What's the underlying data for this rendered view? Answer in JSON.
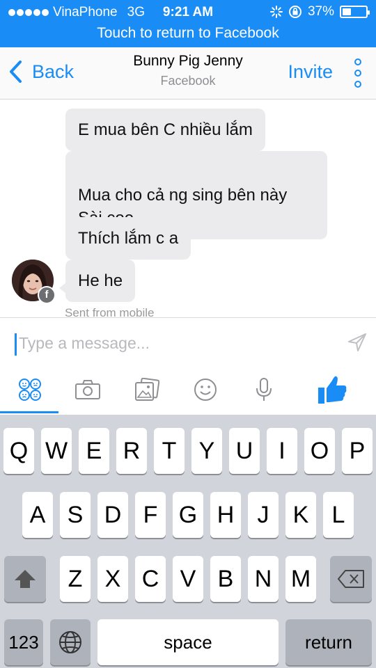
{
  "status_bar": {
    "carrier": "VinaPhone",
    "network": "3G",
    "time": "9:21 AM",
    "battery_percent": "37%",
    "battery_level": 0.37,
    "icons": [
      "signal-dots-icon",
      "activity-spinner-icon",
      "rotation-lock-icon",
      "battery-icon"
    ]
  },
  "return_bar": {
    "label": "Touch to return to Facebook"
  },
  "nav": {
    "back_label": "Back",
    "title": "Bunny Pig Jenny",
    "subtitle": "Facebook",
    "invite_label": "Invite",
    "more_icon": "vertical-dots-icon"
  },
  "messages": [
    {
      "text": "E mua bên C nhiều lắm"
    },
    {
      "text": "Mua cho cả ng sing bên này\nSài coe"
    },
    {
      "text": "Thích lắm c a"
    },
    {
      "text": "He he"
    }
  ],
  "sent_note": "Sent from mobile",
  "composer": {
    "placeholder": "Type a message...",
    "send_icon": "send-arrow-icon"
  },
  "toolbar": {
    "items": [
      "stickers-icon",
      "camera-icon",
      "gallery-icon",
      "emoji-icon",
      "microphone-icon",
      "like-thumb-icon"
    ],
    "accent": "#1a8cf6"
  },
  "keyboard": {
    "row1": [
      "Q",
      "W",
      "E",
      "R",
      "T",
      "Y",
      "U",
      "I",
      "O",
      "P"
    ],
    "row2": [
      "A",
      "S",
      "D",
      "F",
      "G",
      "H",
      "J",
      "K",
      "L"
    ],
    "row3": [
      "Z",
      "X",
      "C",
      "V",
      "B",
      "N",
      "M"
    ],
    "shift_icon": "shift-arrow-icon",
    "delete_icon": "backspace-icon",
    "numbers_label": "123",
    "globe_icon": "globe-icon",
    "space_label": "space",
    "return_label": "return"
  }
}
